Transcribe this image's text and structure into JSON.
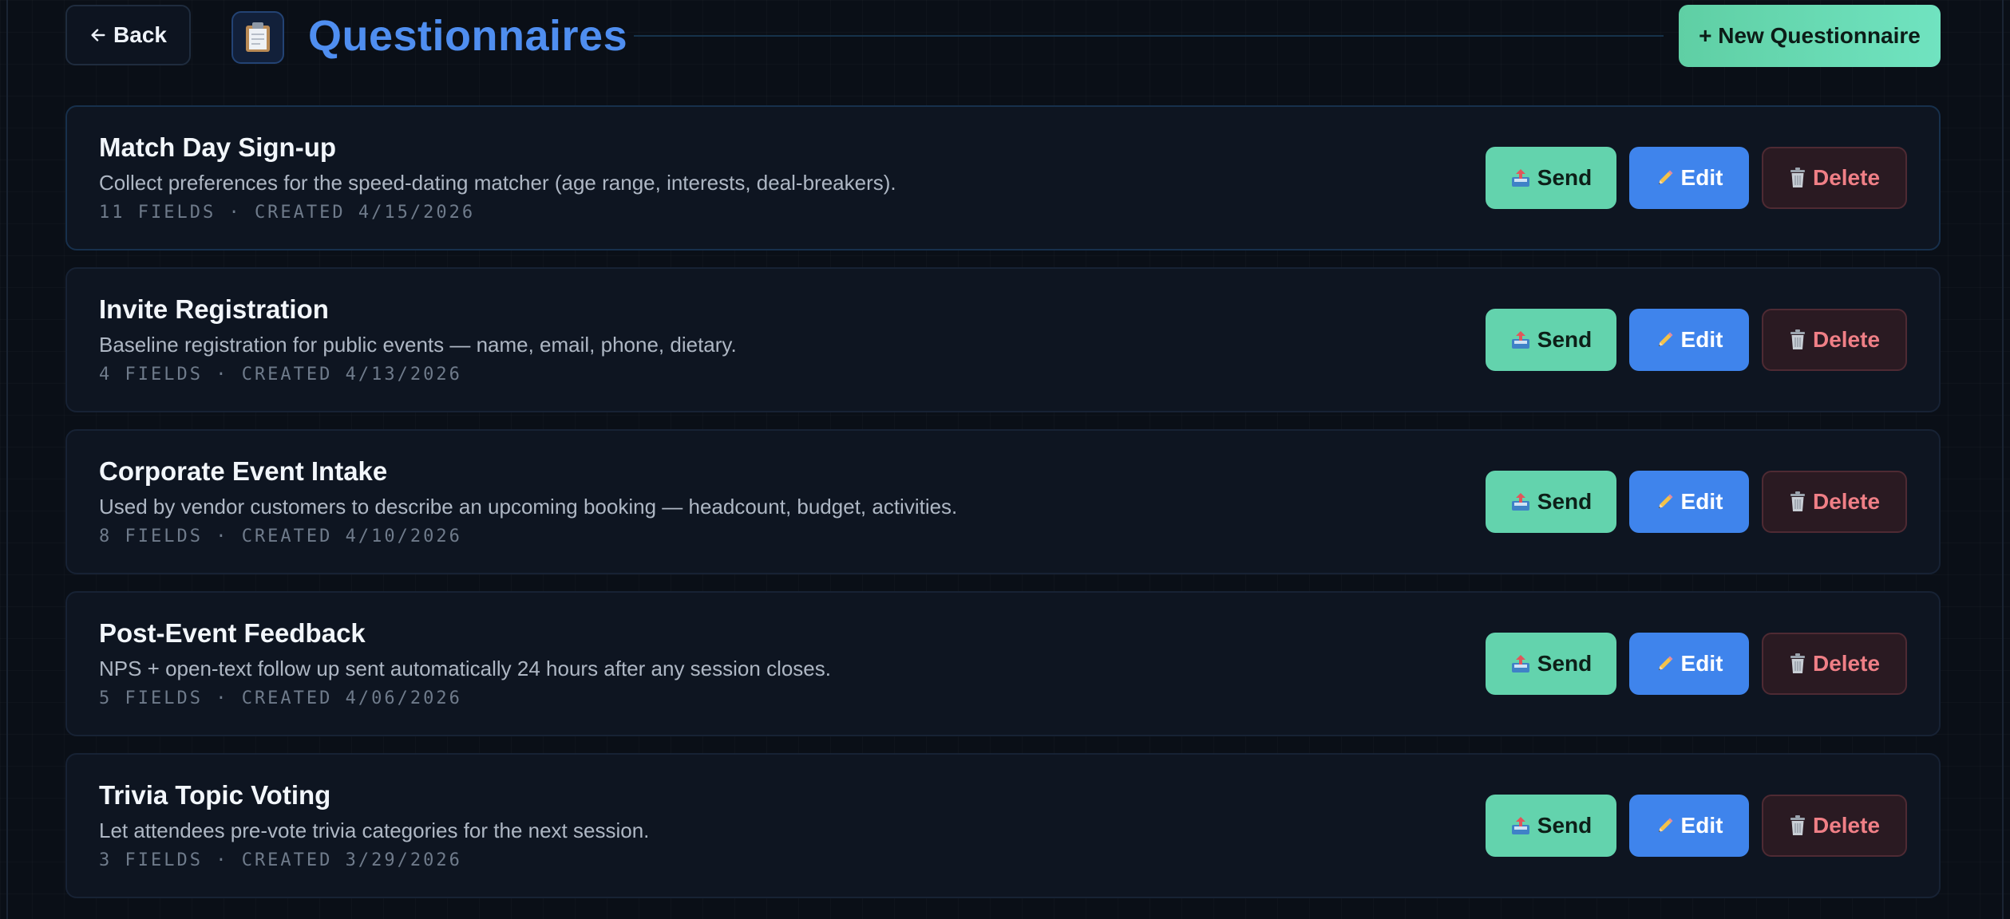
{
  "header": {
    "back_label": "Back",
    "title": "Questionnaires",
    "new_label": "+ New Questionnaire"
  },
  "colors": {
    "accent": "#4f8ef0",
    "send": "#63d3ad",
    "edit": "#3f84ec",
    "delete_text": "#ef7f86"
  },
  "icons": {
    "back": "arrow-left-icon",
    "title": "clipboard-icon",
    "send": "outbox-tray-icon",
    "edit": "pencil-icon",
    "delete": "trash-icon"
  },
  "actions": {
    "send": "Send",
    "edit": "Edit",
    "delete": "Delete"
  },
  "questionnaires": [
    {
      "title": "Match Day Sign-up",
      "description": "Collect preferences for the speed-dating matcher (age range, interests, deal-breakers).",
      "meta": "11 FIELDS · CREATED 4/15/2026"
    },
    {
      "title": "Invite Registration",
      "description": "Baseline registration for public events — name, email, phone, dietary.",
      "meta": "4 FIELDS · CREATED 4/13/2026"
    },
    {
      "title": "Corporate Event Intake",
      "description": "Used by vendor customers to describe an upcoming booking — headcount, budget, activities.",
      "meta": "8 FIELDS · CREATED 4/10/2026"
    },
    {
      "title": "Post-Event Feedback",
      "description": "NPS + open-text follow up sent automatically 24 hours after any session closes.",
      "meta": "5 FIELDS · CREATED 4/06/2026"
    },
    {
      "title": "Trivia Topic Voting",
      "description": "Let attendees pre-vote trivia categories for the next session.",
      "meta": "3 FIELDS · CREATED 3/29/2026"
    }
  ]
}
